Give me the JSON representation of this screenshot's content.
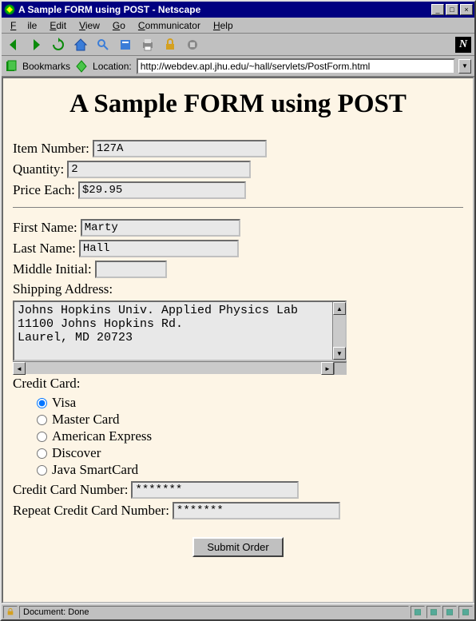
{
  "window": {
    "title": "A Sample FORM using POST - Netscape"
  },
  "menu": {
    "file": "File",
    "edit": "Edit",
    "view": "View",
    "go": "Go",
    "communicator": "Communicator",
    "help": "Help"
  },
  "location": {
    "bookmarks_label": "Bookmarks",
    "location_label": "Location:",
    "url": "http://webdev.apl.jhu.edu/~hall/servlets/PostForm.html"
  },
  "page": {
    "heading": "A Sample FORM using POST",
    "labels": {
      "item_number": "Item Number:",
      "quantity": "Quantity:",
      "price_each": "Price Each:",
      "first_name": "First Name:",
      "last_name": "Last Name:",
      "middle_initial": "Middle Initial:",
      "shipping_address": "Shipping Address:",
      "credit_card": "Credit Card:",
      "cc_number": "Credit Card Number:",
      "cc_repeat": "Repeat Credit Card Number:"
    },
    "values": {
      "item_number": "127A",
      "quantity": "2",
      "price_each": "$29.95",
      "first_name": "Marty",
      "last_name": "Hall",
      "middle_initial": "",
      "shipping_address": "Johns Hopkins Univ. Applied Physics Lab\n11100 Johns Hopkins Rd.\nLaurel, MD 20723",
      "cc_number": "*******",
      "cc_repeat": "*******"
    },
    "card_options": {
      "visa": "Visa",
      "mastercard": "Master Card",
      "amex": "American Express",
      "discover": "Discover",
      "javasmartcard": "Java SmartCard"
    },
    "selected_card": "visa",
    "submit_label": "Submit Order"
  },
  "status": {
    "text": "Document: Done"
  }
}
